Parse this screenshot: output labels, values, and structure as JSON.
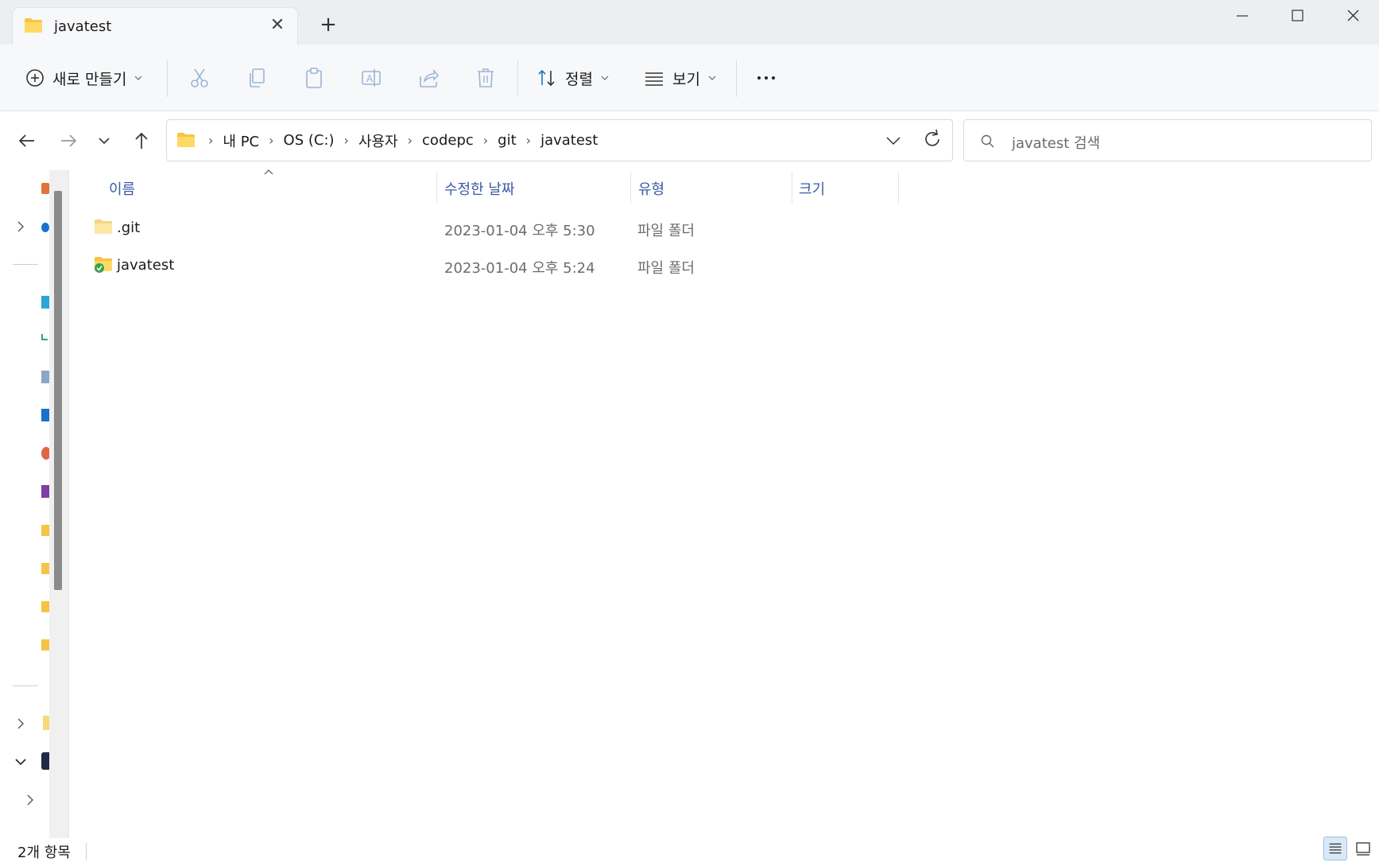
{
  "window": {
    "tab_title": "javatest"
  },
  "toolbar": {
    "new_label": "새로 만들기",
    "sort_label": "정렬",
    "view_label": "보기",
    "more_label": "···"
  },
  "address": {
    "crumbs": [
      "내 PC",
      "OS (C:)",
      "사용자",
      "codepc",
      "git",
      "javatest"
    ]
  },
  "search": {
    "placeholder": "javatest 검색"
  },
  "columns": {
    "name": "이름",
    "modified": "수정한 날짜",
    "type": "유형",
    "size": "크기"
  },
  "files": [
    {
      "name": ".git",
      "modified": "2023-01-04 오후 5:30",
      "type": "파일 폴더",
      "size": "",
      "icon": "folder-icon"
    },
    {
      "name": "javatest",
      "modified": "2023-01-04 오후 5:24",
      "type": "파일 폴더",
      "size": "",
      "icon": "synced-folder-icon"
    }
  ],
  "status": {
    "item_count": "2개 항목"
  },
  "colors": {
    "folder": "#f6c445",
    "header_text": "#3b5ba5",
    "accent": "#1a73c9"
  }
}
